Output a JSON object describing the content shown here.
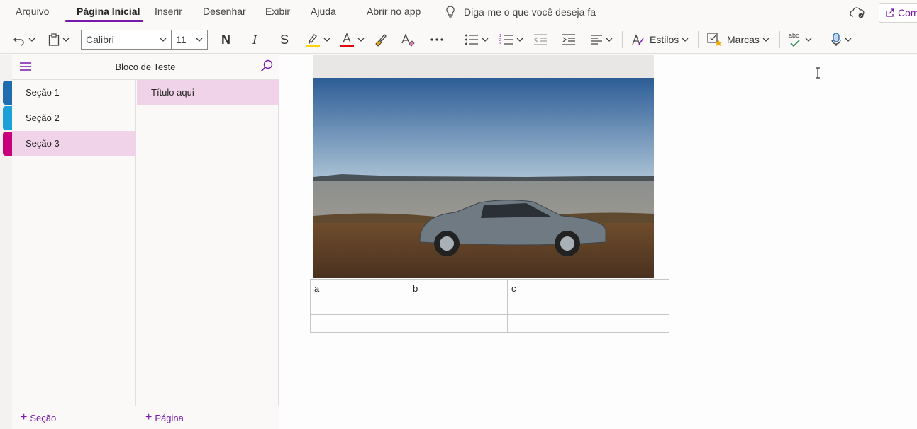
{
  "menu": {
    "items": [
      "Arquivo",
      "Página Inicial",
      "Inserir",
      "Desenhar",
      "Exibir",
      "Ajuda",
      "Abrir no app"
    ],
    "tell_me": "Diga-me o que você deseja fa",
    "share_label": "Com"
  },
  "toolbar": {
    "font_name": "Calibri",
    "font_size": "11",
    "bold": "N",
    "italic": "I",
    "strike": "S",
    "styles_label": "Estilos",
    "tags_label": "Marcas",
    "spell_label": "abc",
    "highlight_color": "#ffd400",
    "font_color": "#e00b0b"
  },
  "notebook": {
    "title": "Bloco de Teste",
    "sections": [
      {
        "label": "Seção 1",
        "color": "#1f6cb0"
      },
      {
        "label": "Seção 2",
        "color": "#1ba1d7"
      },
      {
        "label": "Seção 3",
        "color": "#c9007a"
      }
    ],
    "active_section": "Seção 3",
    "pages": [
      {
        "label": "Título aqui"
      }
    ],
    "add_section": "Seção",
    "add_page": "Página"
  },
  "canvas": {
    "table": [
      [
        "a",
        "b",
        "c"
      ],
      [
        "",
        "",
        ""
      ],
      [
        "",
        "",
        ""
      ]
    ]
  },
  "colors": {
    "accent": "#7719aa",
    "active_bg": "#f0d3e9"
  }
}
